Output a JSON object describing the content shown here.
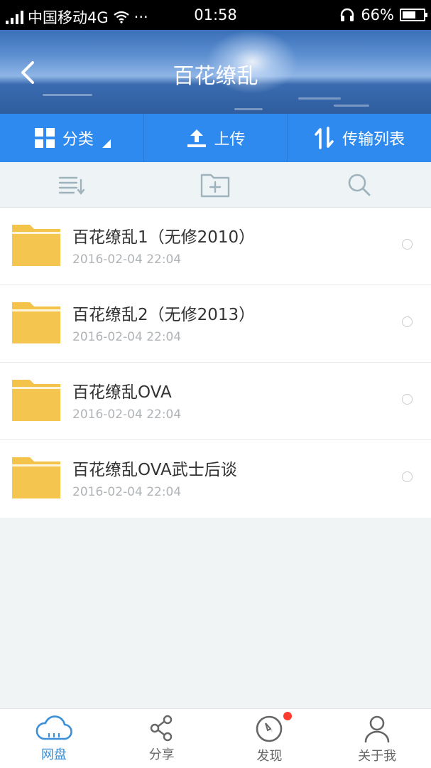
{
  "status_bar": {
    "carrier": "中国移动4G",
    "time": "01:58",
    "battery": "66%",
    "battery_level": 0.66,
    "dots": "···"
  },
  "header": {
    "title": "百花缭乱",
    "back_icon": "chevron-left-icon"
  },
  "actions": [
    {
      "label": "分类",
      "icon": "grid-icon"
    },
    {
      "label": "上传",
      "icon": "upload-icon"
    },
    {
      "label": "传输列表",
      "icon": "transfer-arrows-icon"
    }
  ],
  "toolbar": {
    "sort_icon": "sort-list-icon",
    "new_folder_icon": "new-folder-icon",
    "search_icon": "search-icon"
  },
  "files": [
    {
      "name": "百花缭乱1（无修2010）",
      "date": "2016-02-04  22:04"
    },
    {
      "name": "百花缭乱2（无修2013）",
      "date": "2016-02-04  22:04"
    },
    {
      "name": "百花缭乱OVA",
      "date": "2016-02-04  22:04"
    },
    {
      "name": "百花缭乱OVA武士后谈",
      "date": "2016-02-04  22:04"
    }
  ],
  "tabs": [
    {
      "label": "网盘",
      "icon": "cloud-icon",
      "active": true
    },
    {
      "label": "分享",
      "icon": "share-icon",
      "active": false
    },
    {
      "label": "发现",
      "icon": "compass-icon",
      "active": false,
      "badge": true
    },
    {
      "label": "关于我",
      "icon": "user-icon",
      "active": false
    }
  ],
  "colors": {
    "accent": "#2f8af0",
    "active_tab": "#3a8fd8",
    "folder": "#f3c34a",
    "badge": "#ff3b30"
  }
}
